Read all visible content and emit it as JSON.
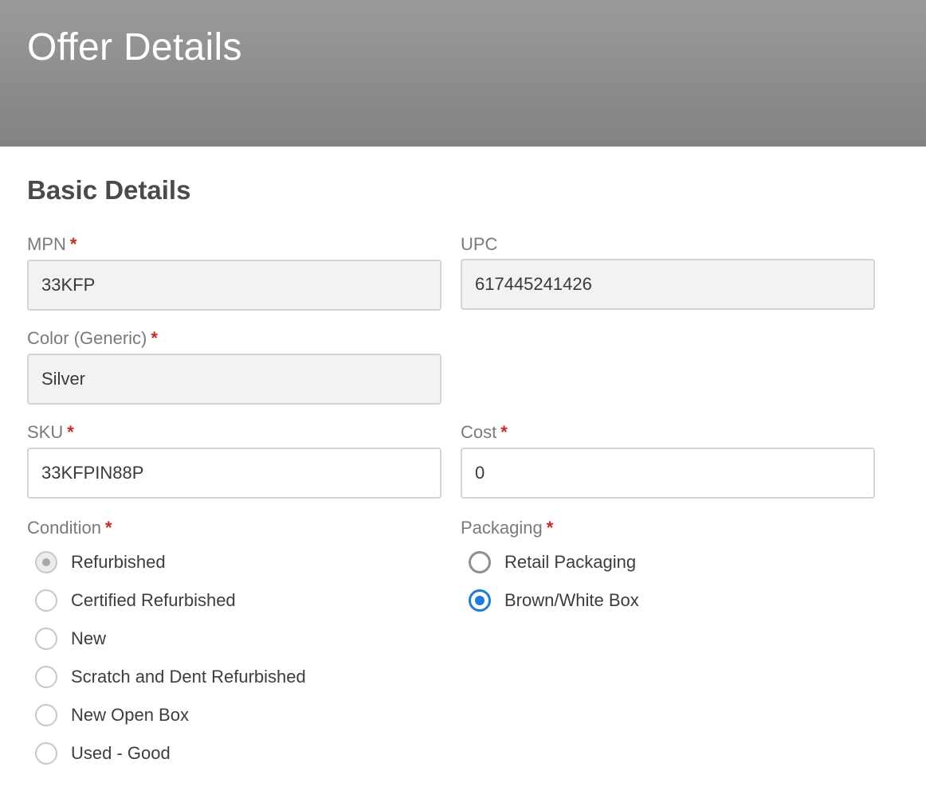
{
  "header": {
    "title": "Offer Details"
  },
  "section": {
    "title": "Basic Details"
  },
  "fields": {
    "mpn": {
      "label": "MPN",
      "required": "*",
      "value": "33KFP"
    },
    "upc": {
      "label": "UPC",
      "value": "617445241426"
    },
    "color": {
      "label": "Color (Generic)",
      "required": "*",
      "value": "Silver"
    },
    "sku": {
      "label": "SKU",
      "required": "*",
      "value": "33KFPIN88P"
    },
    "cost": {
      "label": "Cost",
      "required": "*",
      "value": "0"
    }
  },
  "condition": {
    "label": "Condition",
    "required": "*",
    "selected": "Refurbished",
    "options": [
      "Refurbished",
      "Certified Refurbished",
      "New",
      "Scratch and Dent Refurbished",
      "New Open Box",
      "Used - Good"
    ]
  },
  "packaging": {
    "label": "Packaging",
    "required": "*",
    "selected": "Brown/White Box",
    "options": [
      "Retail Packaging",
      "Brown/White Box"
    ]
  },
  "colors": {
    "header_bg": "#8c8c8c",
    "accent": "#1f7ae0",
    "required": "#d0281e"
  }
}
